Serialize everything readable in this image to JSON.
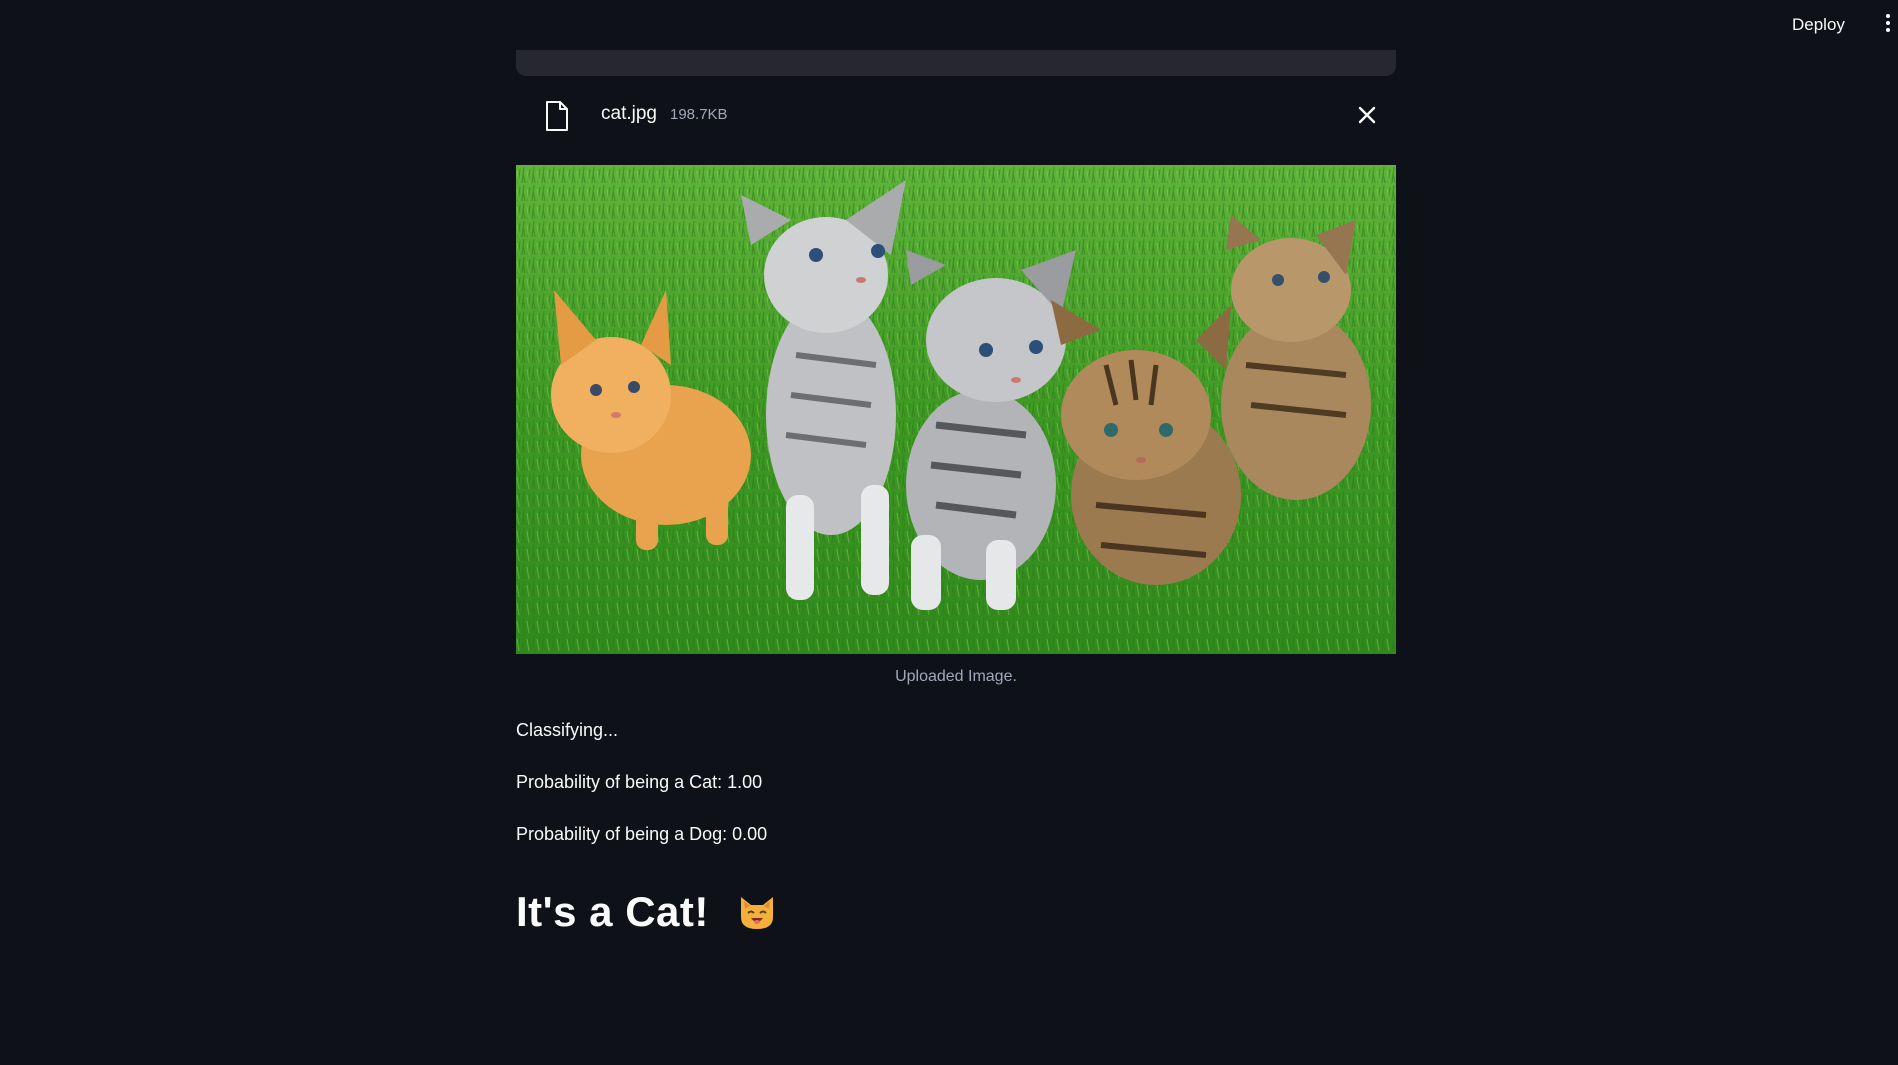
{
  "header": {
    "deploy_label": "Deploy",
    "menu_icon": "vertical-dots-icon"
  },
  "uploader": {
    "file": {
      "name": "cat.jpg",
      "size": "198.7KB",
      "icon": "file-icon",
      "remove_icon": "close-icon"
    }
  },
  "image": {
    "caption": "Uploaded Image."
  },
  "results": {
    "status": "Classifying...",
    "cat_probability": "Probability of being a Cat: 1.00",
    "dog_probability": "Probability of being a Dog: 0.00",
    "verdict": "It's a Cat!",
    "verdict_icon": "cat-face-emoji"
  },
  "colors": {
    "background": "#0e1117",
    "text": "#fafafa",
    "muted": "#a3a8b8",
    "surface": "#262730"
  }
}
